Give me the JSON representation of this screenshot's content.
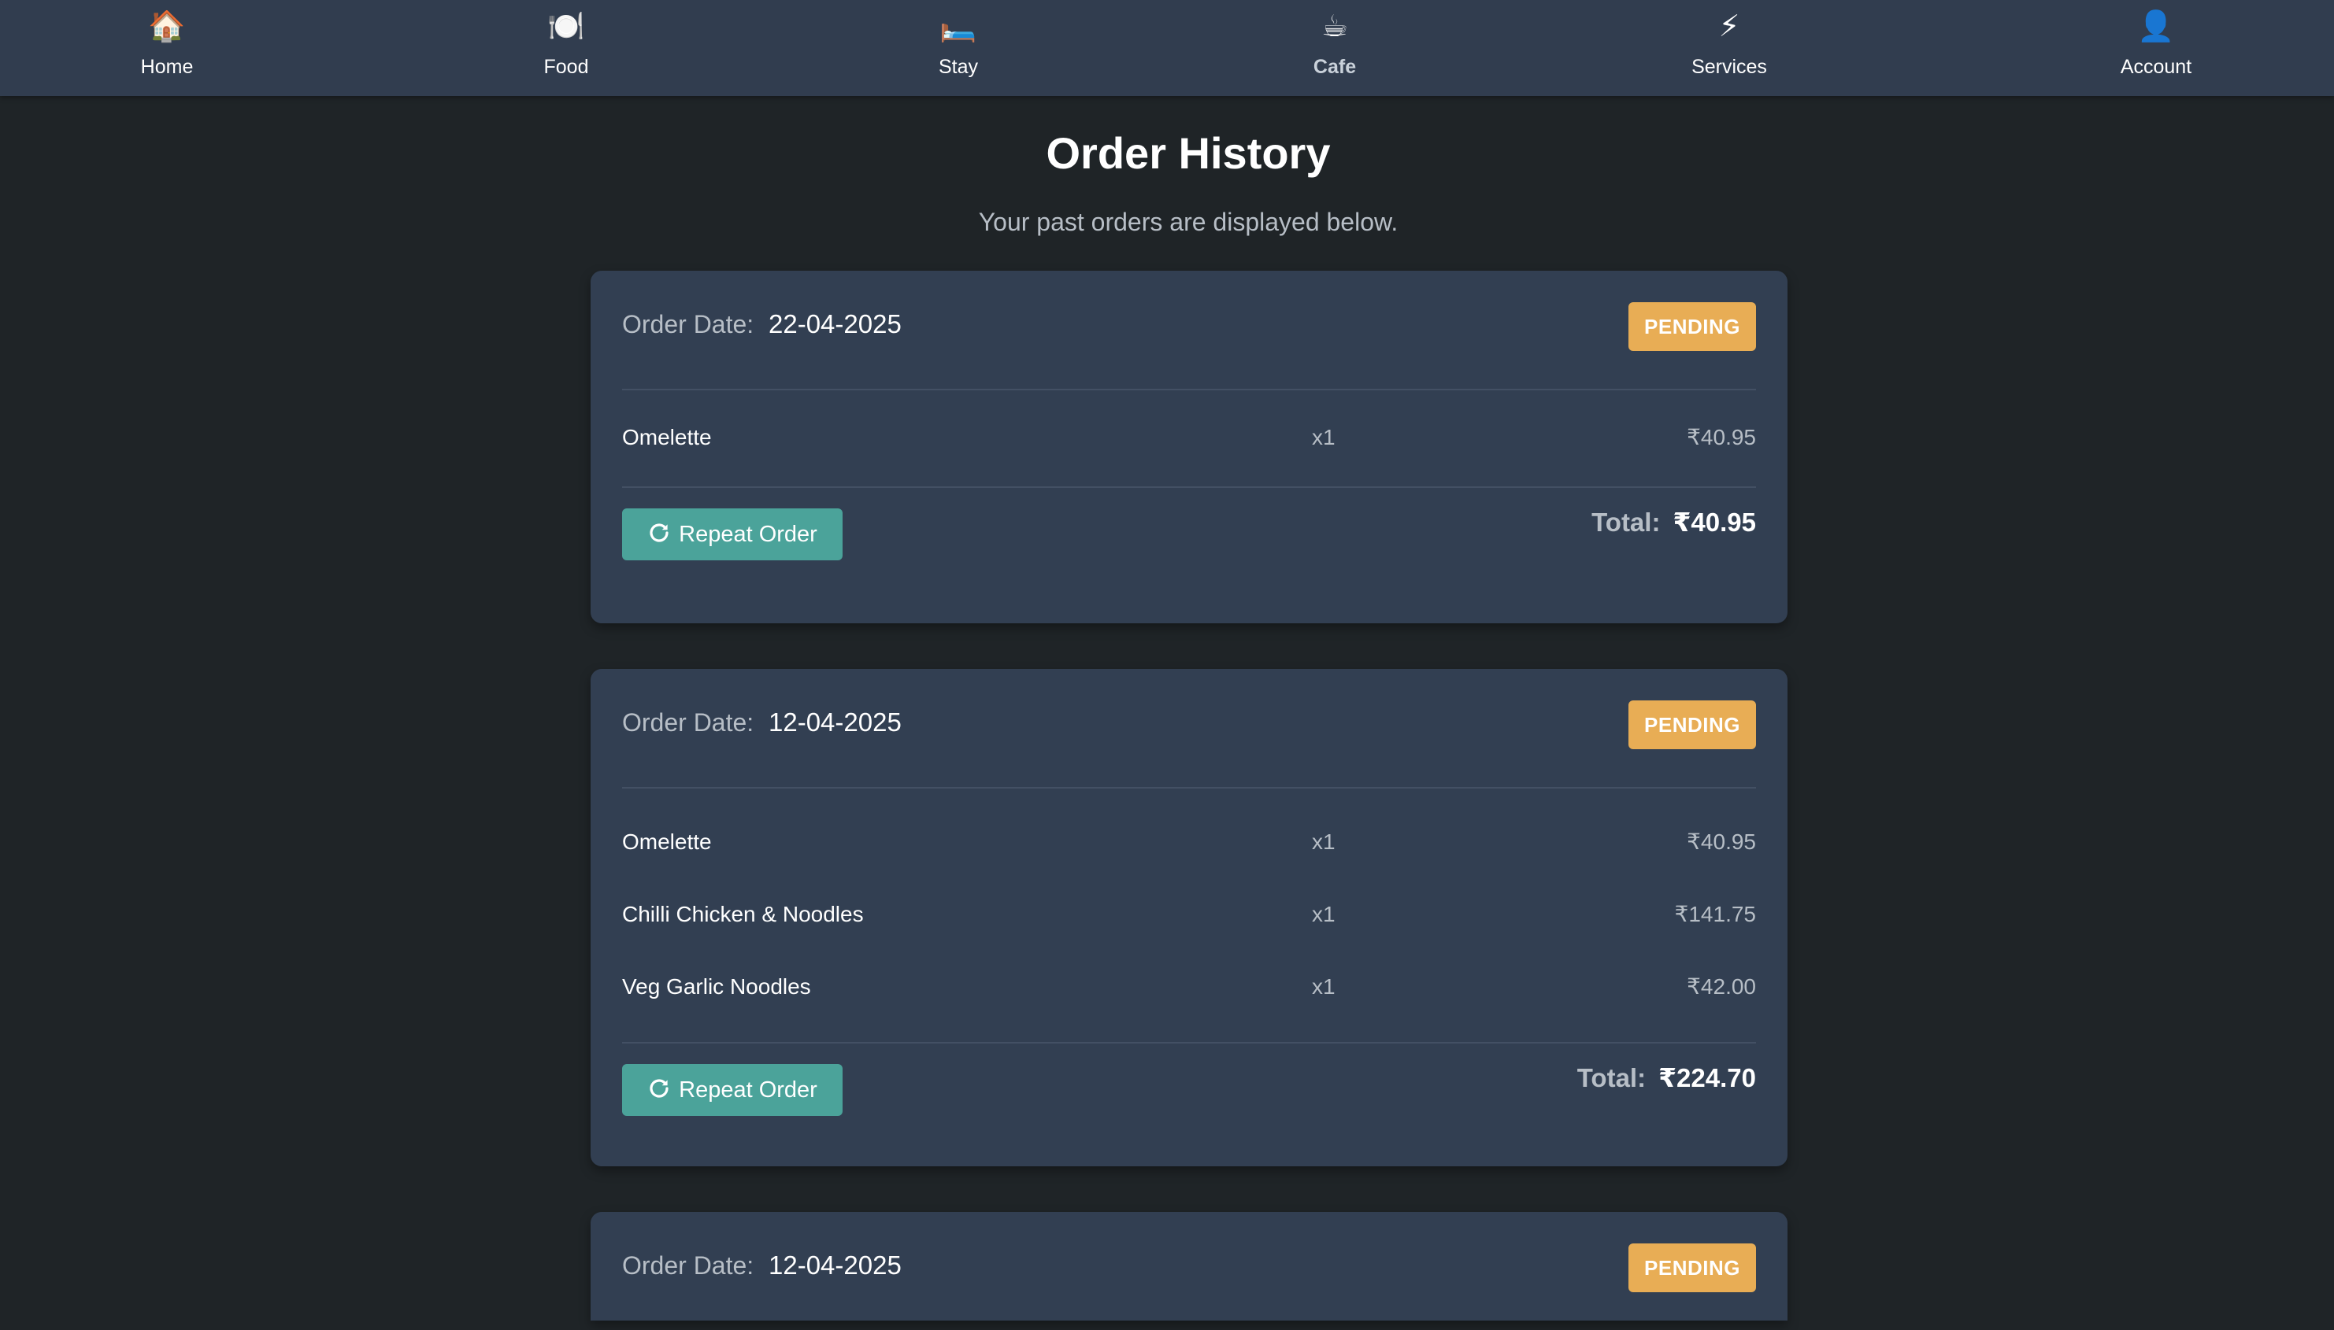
{
  "nav": {
    "items": [
      {
        "label": "Home",
        "icon": "🏠"
      },
      {
        "label": "Food",
        "icon": "🍽️"
      },
      {
        "label": "Stay",
        "icon": "🛏️"
      },
      {
        "label": "Cafe",
        "icon": "☕"
      },
      {
        "label": "Services",
        "icon": "⚡"
      },
      {
        "label": "Account",
        "icon": "👤"
      }
    ],
    "active": "Cafe"
  },
  "page": {
    "title": "Order History",
    "subtitle": "Your past orders are displayed below."
  },
  "orders": [
    {
      "date_label": "Order Date:",
      "date": "22-04-2025",
      "status": "PENDING",
      "items": [
        {
          "name": "Omelette",
          "qty": "x1",
          "price": "₹40.95"
        }
      ],
      "repeat_label": "Repeat Order",
      "total_label": "Total:",
      "total": "₹40.95"
    },
    {
      "date_label": "Order Date:",
      "date": "12-04-2025",
      "status": "PENDING",
      "items": [
        {
          "name": "Omelette",
          "qty": "x1",
          "price": "₹40.95"
        },
        {
          "name": "Chilli Chicken & Noodles",
          "qty": "x1",
          "price": "₹141.75"
        },
        {
          "name": "Veg Garlic Noodles",
          "qty": "x1",
          "price": "₹42.00"
        }
      ],
      "repeat_label": "Repeat Order",
      "total_label": "Total:",
      "total": "₹224.70"
    },
    {
      "date_label": "Order Date:",
      "date": "12-04-2025",
      "status": "PENDING"
    }
  ],
  "colors": {
    "background": "#1f2427",
    "nav_background": "#313d4f",
    "card_background": "#323f52",
    "status_pending": "#e8ad55",
    "repeat_button": "#4ba39a"
  }
}
